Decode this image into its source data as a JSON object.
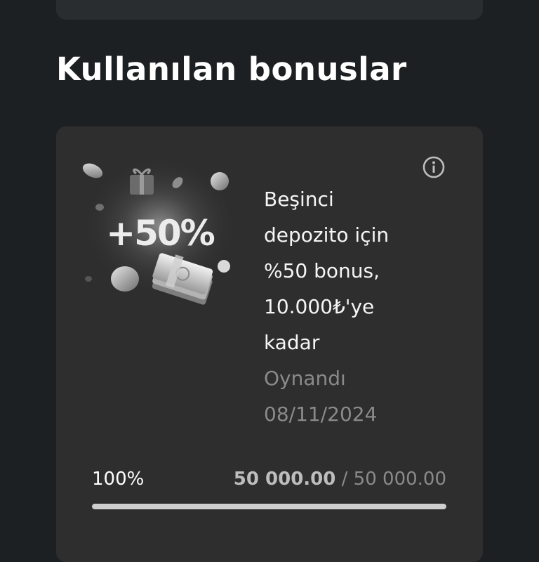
{
  "section": {
    "title": "Kullanılan bonuslar"
  },
  "bonus": {
    "title_lines": [
      "Beşinci",
      "depozito için",
      "%50 bonus,",
      "10.000₺'ye",
      "kadar"
    ],
    "status": "Oynandı",
    "date": "08/11/2024",
    "image_badge": "+50%",
    "info_icon": "info-icon"
  },
  "progress": {
    "percent_label": "100%",
    "fraction": 1.0,
    "current": "50 000.00",
    "separator": "/",
    "total": "50 000.00"
  },
  "colors": {
    "background": "#1d2022",
    "card": "#2e2e2e",
    "text": "#ffffff",
    "muted": "#8a8a8a",
    "progress_fill": "#cfcfcf"
  }
}
